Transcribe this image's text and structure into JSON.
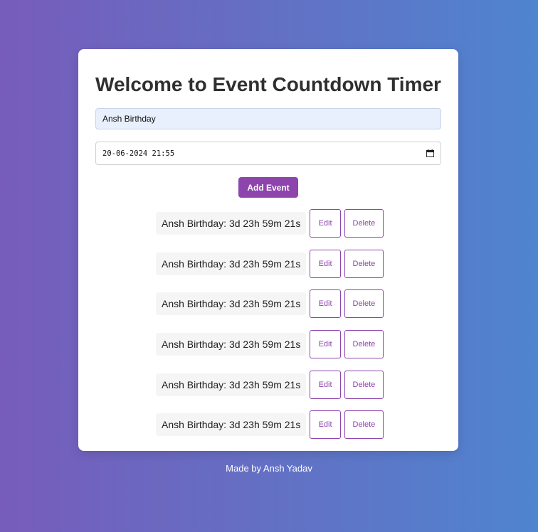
{
  "header": {
    "title": "Welcome to Event Countdown Timer"
  },
  "form": {
    "event_name_value": "Ansh Birthday",
    "event_datetime_value": "20-06-2024 21:55",
    "add_button_label": "Add Event"
  },
  "events": [
    {
      "label": "Ansh Birthday: 3d 23h 59m 21s",
      "edit_label": "Edit",
      "delete_label": "Delete"
    },
    {
      "label": "Ansh Birthday: 3d 23h 59m 21s",
      "edit_label": "Edit",
      "delete_label": "Delete"
    },
    {
      "label": "Ansh Birthday: 3d 23h 59m 21s",
      "edit_label": "Edit",
      "delete_label": "Delete"
    },
    {
      "label": "Ansh Birthday: 3d 23h 59m 21s",
      "edit_label": "Edit",
      "delete_label": "Delete"
    },
    {
      "label": "Ansh Birthday: 3d 23h 59m 21s",
      "edit_label": "Edit",
      "delete_label": "Delete"
    },
    {
      "label": "Ansh Birthday: 3d 23h 59m 21s",
      "edit_label": "Edit",
      "delete_label": "Delete"
    }
  ],
  "footer": {
    "credit": "Made by Ansh Yadav"
  },
  "colors": {
    "accent": "#8e44ad",
    "background_start": "#775cbb",
    "background_end": "#4f84cf"
  }
}
